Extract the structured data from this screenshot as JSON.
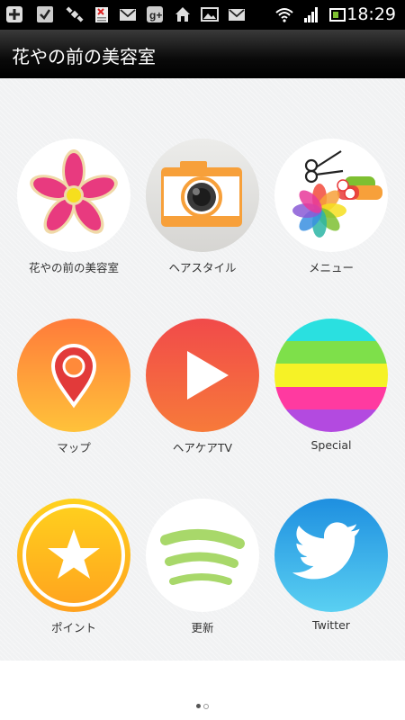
{
  "status_bar": {
    "time": "18:29",
    "left_icons": [
      "add-icon",
      "check-icon",
      "satellite-icon",
      "document-error-icon",
      "mail-icon",
      "google-plus-icon",
      "home-icon",
      "image-icon",
      "mail-icon"
    ],
    "right_icons": [
      "wifi-icon",
      "signal-icon",
      "battery-icon"
    ]
  },
  "app_bar": {
    "title": "花やの前の美容室"
  },
  "grid": {
    "items": [
      {
        "label": "花やの前の美容室",
        "icon": "flower-icon"
      },
      {
        "label": "ヘアスタイル",
        "icon": "camera-icon"
      },
      {
        "label": "メニュー",
        "icon": "menu-tools-icon"
      },
      {
        "label": "マップ",
        "icon": "map-pin-icon"
      },
      {
        "label": "ヘアケアTV",
        "icon": "play-icon"
      },
      {
        "label": "Special",
        "icon": "stripes-icon"
      },
      {
        "label": "ポイント",
        "icon": "star-icon"
      },
      {
        "label": "更新",
        "icon": "refresh-icon"
      },
      {
        "label": "Twitter",
        "icon": "twitter-bird-icon"
      }
    ]
  },
  "pager": {
    "page_count": 2,
    "current_page": 1
  },
  "colors": {
    "status_bar": "#000000",
    "app_bar": "#111111",
    "background": "#f1f2f3",
    "label_text": "#333333"
  }
}
